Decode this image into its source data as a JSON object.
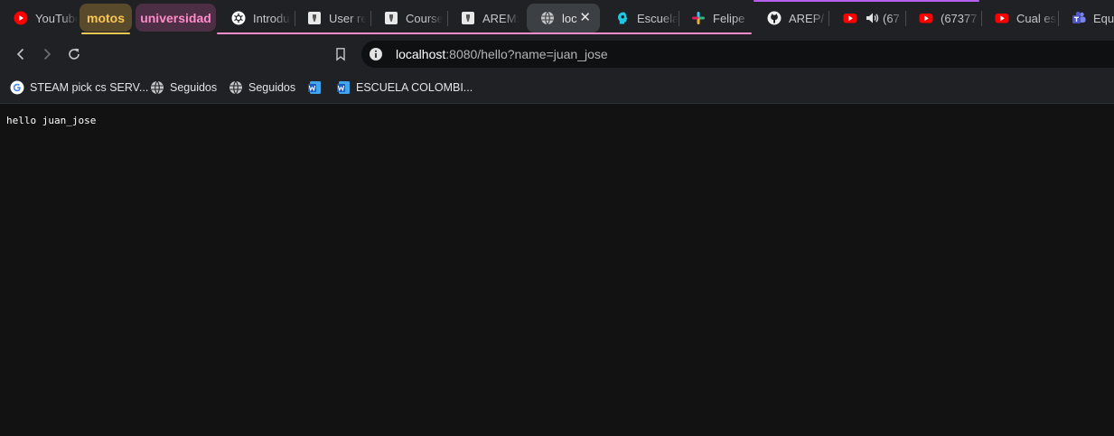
{
  "tabs": [
    {
      "label": "YouTube",
      "icon": "youtube-icon"
    },
    {
      "label": "Introdu",
      "icon": "openai-icon"
    },
    {
      "label": "User re",
      "icon": "document-icon"
    },
    {
      "label": "Course",
      "icon": "document-icon"
    },
    {
      "label": "AREM:",
      "icon": "document-icon"
    },
    {
      "label": "loc",
      "icon": "globe-icon",
      "active": true
    },
    {
      "label": "Escuela",
      "icon": "head-icon"
    },
    {
      "label": "Felipe",
      "icon": "slack-icon"
    },
    {
      "label": "AREP/",
      "icon": "github-icon"
    },
    {
      "label": "(67",
      "icon": "youtube-icon",
      "audio": true
    },
    {
      "label": "(67377",
      "icon": "youtube-icon"
    },
    {
      "label": "Cual es",
      "icon": "youtube-icon"
    },
    {
      "label": "Equi",
      "icon": "teams-icon"
    }
  ],
  "tab_groups": [
    {
      "label": "motos",
      "color": "#f9c854",
      "bg": "#5a4a2c"
    },
    {
      "label": "universidad",
      "color": "#ff8bcb",
      "bg": "#4d2f45"
    },
    {
      "label": "",
      "color": "#b55ff0",
      "bg": ""
    }
  ],
  "omnibox": {
    "host": "localhost",
    "path": ":8080/hello?name=juan_jose"
  },
  "bookmarks": [
    {
      "label": "STEAM pick cs SERV...",
      "icon": "google-icon"
    },
    {
      "label": "Seguidos",
      "icon": "globe-icon"
    },
    {
      "label": "Seguidos",
      "icon": "globe-icon"
    },
    {
      "label": "",
      "icon": "word-icon"
    },
    {
      "label": "ESCUELA COLOMBI...",
      "icon": "word-icon"
    }
  ],
  "page": {
    "text": "hello juan_jose"
  },
  "colors": {
    "page_bg": "#121212",
    "chrome_bg": "#1f2125",
    "active_tab": "#3c3f44",
    "youtube": "#ff0000"
  }
}
